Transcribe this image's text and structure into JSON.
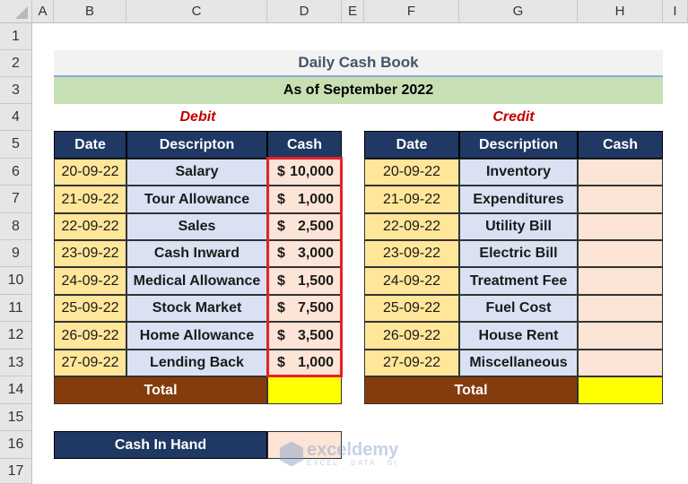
{
  "columns": [
    "A",
    "B",
    "C",
    "D",
    "E",
    "F",
    "G",
    "H",
    "I"
  ],
  "rows": [
    "1",
    "2",
    "3",
    "4",
    "5",
    "6",
    "7",
    "8",
    "9",
    "10",
    "11",
    "12",
    "13",
    "14",
    "15",
    "16",
    "17"
  ],
  "title": "Daily Cash Book",
  "subtitle": "As of September 2022",
  "debit": {
    "label": "Debit",
    "headers": [
      "Date",
      "Descripton",
      "Cash"
    ],
    "rows": [
      {
        "date": "20-09-22",
        "desc": "Salary",
        "cur": "$",
        "amt": "10,000"
      },
      {
        "date": "21-09-22",
        "desc": "Tour Allowance",
        "cur": "$",
        "amt": "1,000"
      },
      {
        "date": "22-09-22",
        "desc": "Sales",
        "cur": "$",
        "amt": "2,500"
      },
      {
        "date": "23-09-22",
        "desc": "Cash Inward",
        "cur": "$",
        "amt": "3,000"
      },
      {
        "date": "24-09-22",
        "desc": "Medical Allowance",
        "cur": "$",
        "amt": "1,500"
      },
      {
        "date": "25-09-22",
        "desc": "Stock Market",
        "cur": "$",
        "amt": "7,500"
      },
      {
        "date": "26-09-22",
        "desc": "Home Allowance",
        "cur": "$",
        "amt": "3,500"
      },
      {
        "date": "27-09-22",
        "desc": "Lending Back",
        "cur": "$",
        "amt": "1,000"
      }
    ],
    "total_label": "Total",
    "total_value": ""
  },
  "credit": {
    "label": "Credit",
    "headers": [
      "Date",
      "Description",
      "Cash"
    ],
    "rows": [
      {
        "date": "20-09-22",
        "desc": "Inventory",
        "amt": ""
      },
      {
        "date": "21-09-22",
        "desc": "Expenditures",
        "amt": ""
      },
      {
        "date": "22-09-22",
        "desc": "Utility Bill",
        "amt": ""
      },
      {
        "date": "23-09-22",
        "desc": "Electric Bill",
        "amt": ""
      },
      {
        "date": "24-09-22",
        "desc": "Treatment Fee",
        "amt": ""
      },
      {
        "date": "25-09-22",
        "desc": "Fuel Cost",
        "amt": ""
      },
      {
        "date": "26-09-22",
        "desc": "House Rent",
        "amt": ""
      },
      {
        "date": "27-09-22",
        "desc": "Miscellaneous",
        "amt": ""
      }
    ],
    "total_label": "Total",
    "total_value": ""
  },
  "cash_in_hand": {
    "label": "Cash In Hand",
    "value": ""
  },
  "watermark": {
    "name": "exceldemy",
    "tagline": "EXCEL · DATA · BI"
  }
}
